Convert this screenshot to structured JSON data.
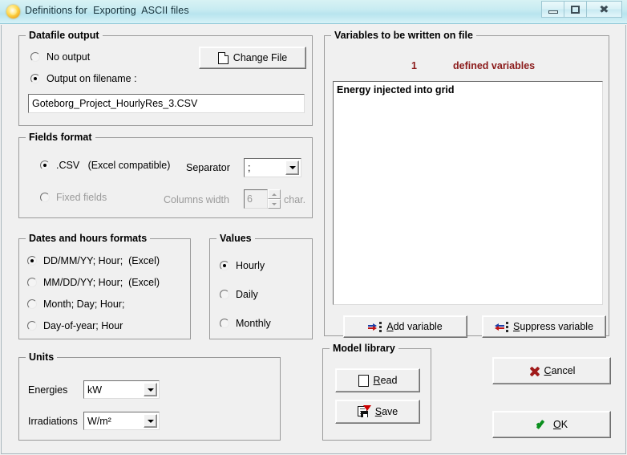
{
  "window": {
    "title": "Definitions for  Exporting  ASCII files",
    "app_icon": "sun-icon",
    "controls": {
      "minimize": "minimize-icon",
      "maximize": "maximize-icon",
      "close": "close-icon"
    }
  },
  "datafile_output": {
    "legend": "Datafile output",
    "options": [
      {
        "label": "No output",
        "selected": false
      },
      {
        "label": "Output on filename :",
        "selected": true
      }
    ],
    "filename": "Goteborg_Project_HourlyRes_3.CSV",
    "change_file_button": "Change File"
  },
  "fields_format": {
    "legend": "Fields format",
    "options": [
      {
        "label": ".CSV   (Excel compatible)",
        "selected": true
      },
      {
        "label": "Fixed fields",
        "selected": false
      }
    ],
    "separator_label": "Separator",
    "separator_value": ";",
    "columns_width_label": "Columns width",
    "columns_width_value": "6",
    "columns_width_unit": "char."
  },
  "dates_hours": {
    "legend": "Dates and hours formats",
    "options": [
      {
        "label": "DD/MM/YY; Hour;  (Excel)",
        "selected": true
      },
      {
        "label": "MM/DD/YY; Hour;  (Excel)",
        "selected": false
      },
      {
        "label": "Month; Day; Hour;",
        "selected": false
      },
      {
        "label": "Day-of-year; Hour",
        "selected": false
      }
    ]
  },
  "values": {
    "legend": "Values",
    "options": [
      {
        "label": "Hourly",
        "selected": true
      },
      {
        "label": "Daily",
        "selected": false
      },
      {
        "label": "Monthly",
        "selected": false
      }
    ]
  },
  "units": {
    "legend": "Units",
    "energies_label": "Energies",
    "energies_value": "kW",
    "irradiations_label": "Irradiations",
    "irradiations_value": "W/m²"
  },
  "variables": {
    "legend": "Variables to be written on file",
    "count": "1",
    "count_label": "defined variables",
    "items": [
      "Energy injected into grid"
    ],
    "add_button_accel": "A",
    "add_button_rest": "dd variable",
    "suppress_button_accel": "S",
    "suppress_button_rest": "uppress variable"
  },
  "model_library": {
    "legend": "Model library",
    "read_accel": "R",
    "read_rest": "ead",
    "save_accel": "S",
    "save_rest": "ave"
  },
  "dialog_buttons": {
    "cancel_accel": "C",
    "cancel_rest": "ancel",
    "ok_accel": "O",
    "ok_rest": "K"
  },
  "colors": {
    "titlebar": "#c8ecf2",
    "face": "#f0f0f0",
    "accent_red": "#8b1a1a",
    "ok_green": "#0b8f1e",
    "cancel_red": "#a01a1a"
  }
}
